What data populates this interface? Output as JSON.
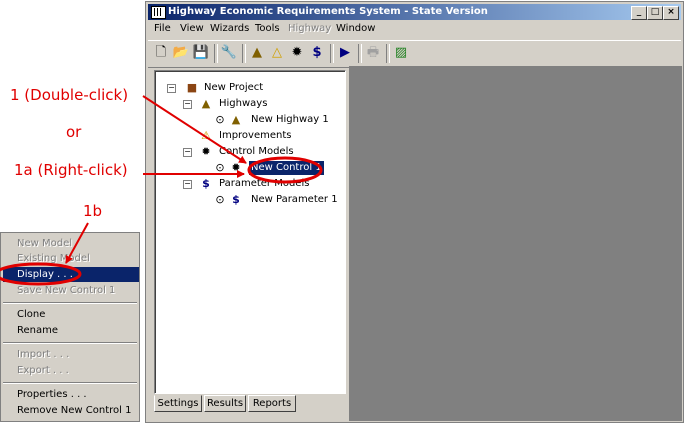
{
  "window": {
    "title": "Highway Economic Requirements System - State Version",
    "controls": {
      "minimize": "_",
      "maximize": "□",
      "close": "×"
    }
  },
  "menu": {
    "items": [
      "File",
      "View",
      "Wizards",
      "Tools",
      "Highway",
      "Window"
    ],
    "disabled": [
      "Highway"
    ]
  },
  "toolbar": {
    "icons": [
      "new-file-icon",
      "open-folder-icon",
      "save-icon",
      "wrench-icon",
      "new-highway-icon",
      "new-improvement-icon",
      "new-control-icon",
      "new-parameter-icon",
      "run-icon",
      "print-icon",
      "report-icon"
    ]
  },
  "tree": {
    "new_project": "New Project",
    "highways": "Highways",
    "new_highway": "New Highway 1",
    "improvements": "Improvements",
    "control_models": "Control Models",
    "new_control": "New Control 1",
    "parameter_models": "Parameter Models",
    "new_parameter": "New Parameter 1"
  },
  "tabs": [
    "Settings",
    "Results",
    "Reports"
  ],
  "context_menu": {
    "new_model": "New Model",
    "existing_model": "Existing Model",
    "display": "Display . . .",
    "save": "Save New Control 1",
    "clone": "Clone",
    "rename": "Rename",
    "import": "Import . . .",
    "export": "Export . . .",
    "properties": "Properties . . .",
    "remove": "Remove New Control 1"
  },
  "annotations": {
    "double_click": "1 (Double-click)",
    "or": "or",
    "right_click": "1a (Right-click)",
    "step_1b": "1b",
    "color": "#e00000"
  }
}
